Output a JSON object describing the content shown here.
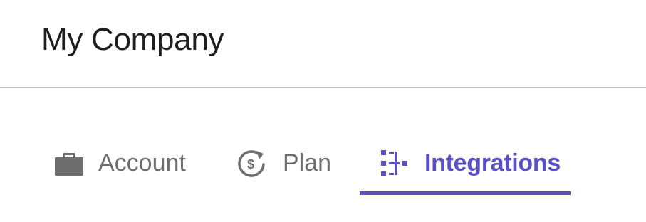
{
  "header": {
    "title": "My Company"
  },
  "tabs": [
    {
      "label": "Account",
      "icon": "briefcase-icon",
      "selected": false
    },
    {
      "label": "Plan",
      "icon": "dollar-refresh-icon",
      "selected": false
    },
    {
      "label": "Integrations",
      "icon": "integrations-tree-icon",
      "selected": true
    }
  ],
  "colors": {
    "accent": "#5b4fc4",
    "inactive": "#6e6e6e",
    "title": "#1f1f1f",
    "divider": "#c4c4c4"
  }
}
